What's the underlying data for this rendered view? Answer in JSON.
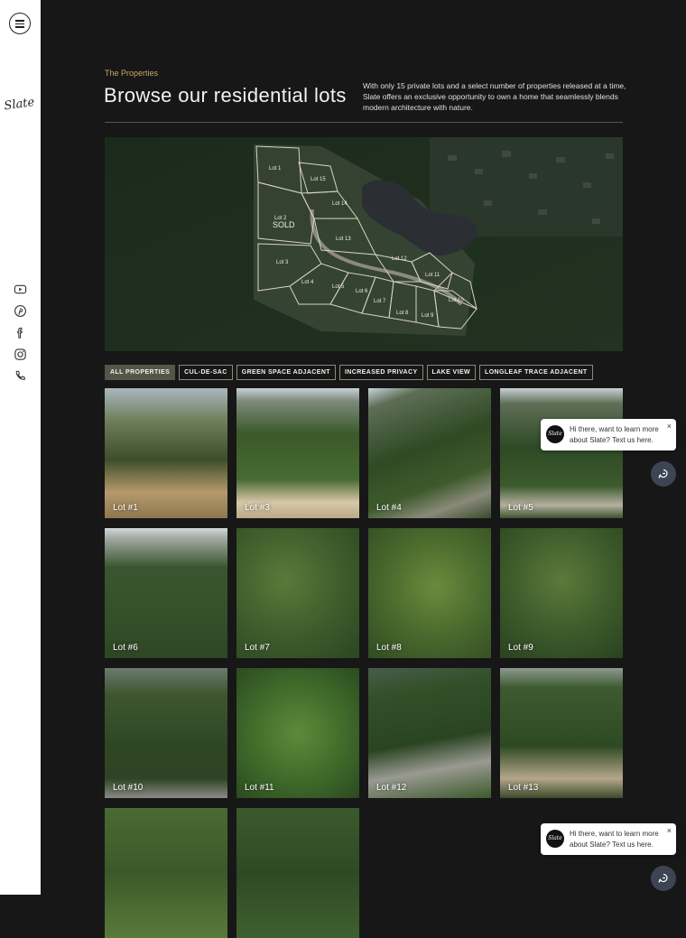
{
  "sidebar": {
    "logo_text": "Slate",
    "icons": [
      "menu-icon",
      "youtube-icon",
      "pinterest-icon",
      "facebook-icon",
      "instagram-icon",
      "phone-icon"
    ]
  },
  "header": {
    "eyebrow": "The Properties",
    "title": "Browse our residential lots",
    "intro": "With only 15 private lots and a select number of properties released at a time, Slate offers an exclusive opportunity to own a home that seamlessly blends modern architecture with nature."
  },
  "map": {
    "lots": [
      "Lot 1",
      "Lot 2",
      "Lot 3",
      "Lot 4",
      "Lot 5",
      "Lot 6",
      "Lot 7",
      "Lot 8",
      "Lot 9",
      "Lot 10",
      "Lot 11",
      "Lot 12",
      "Lot 13",
      "Lot 14",
      "Lot 15"
    ],
    "sold_label": "SOLD"
  },
  "filters": [
    {
      "label": "ALL PROPERTIES",
      "active": true
    },
    {
      "label": "CUL-DE-SAC",
      "active": false
    },
    {
      "label": "GREEN SPACE ADJACENT",
      "active": false
    },
    {
      "label": "INCREASED PRIVACY",
      "active": false
    },
    {
      "label": "LAKE VIEW",
      "active": false
    },
    {
      "label": "LONGLEAF TRACE ADJACENT",
      "active": false
    }
  ],
  "lots": [
    {
      "label": "Lot #1"
    },
    {
      "label": "Lot #3"
    },
    {
      "label": "Lot #4"
    },
    {
      "label": "Lot #5"
    },
    {
      "label": "Lot #6"
    },
    {
      "label": "Lot #7"
    },
    {
      "label": "Lot #8"
    },
    {
      "label": "Lot #9"
    },
    {
      "label": "Lot #10"
    },
    {
      "label": "Lot #11"
    },
    {
      "label": "Lot #12"
    },
    {
      "label": "Lot #13"
    },
    {
      "label": ""
    },
    {
      "label": ""
    }
  ],
  "chat": {
    "message": "Hi there, want to learn more about Slate? Text us here.",
    "close": "×",
    "avatar_text": "Slate"
  },
  "colors": {
    "accent": "#c9a76a",
    "background": "#171717",
    "chat_button": "#3d4555"
  }
}
